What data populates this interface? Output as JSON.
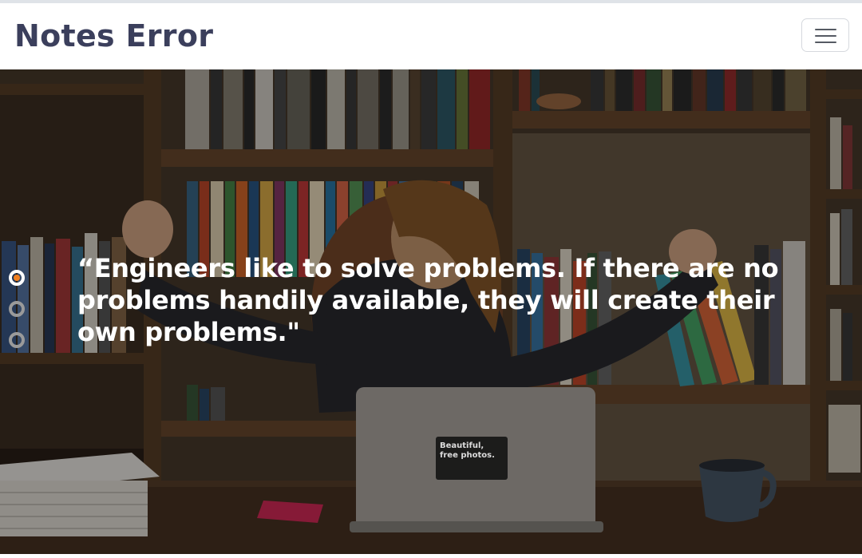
{
  "navbar": {
    "brand": "Notes Error",
    "menu_icon": "hamburger-menu-icon"
  },
  "hero": {
    "quote": "“Engineers like to solve problems. If there are no problems handily available, they will create their own problems.\"",
    "laptop_sticker_line1": "Beautiful,",
    "laptop_sticker_line2": "free photos.",
    "slides": [
      {
        "index": 1,
        "active": true
      },
      {
        "index": 2,
        "active": false
      },
      {
        "index": 3,
        "active": false
      }
    ]
  },
  "colors": {
    "brand_text": "#3b3f5c",
    "active_dot": "#f07f1f",
    "inactive_dot": "#9a9a9a"
  }
}
